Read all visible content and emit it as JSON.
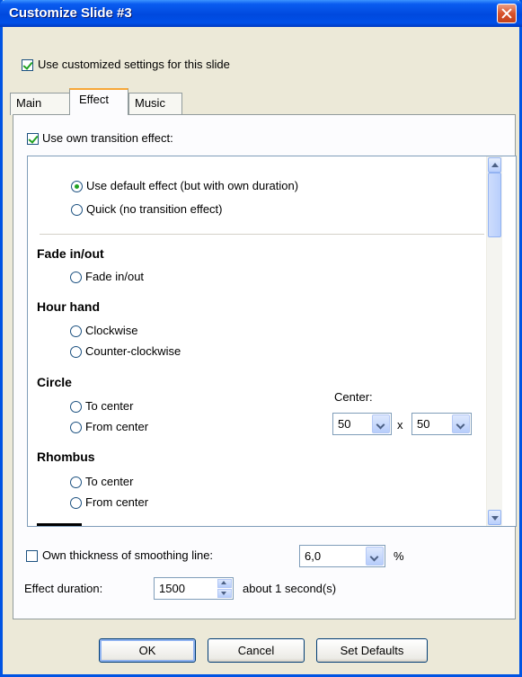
{
  "window": {
    "title": "Customize Slide #3"
  },
  "use_customized": {
    "label": "Use customized settings for this slide",
    "checked": true
  },
  "tabs": [
    {
      "label": "Main",
      "active": false
    },
    {
      "label": "Effect",
      "active": true
    },
    {
      "label": "Music",
      "active": false
    }
  ],
  "own_transition": {
    "label": "Use own transition effect:",
    "checked": true
  },
  "effects": {
    "default_options": [
      {
        "label": "Use default effect (but with own duration)",
        "selected": true
      },
      {
        "label": "Quick (no transition effect)",
        "selected": false
      }
    ],
    "groups": [
      {
        "title": "Fade in/out",
        "options": [
          "Fade in/out"
        ]
      },
      {
        "title": "Hour hand",
        "options": [
          "Clockwise",
          "Counter-clockwise"
        ]
      },
      {
        "title": "Circle",
        "options": [
          "To center",
          "From center"
        ]
      },
      {
        "title": "Rhombus",
        "options": [
          "To center",
          "From center"
        ]
      }
    ],
    "center": {
      "label": "Center:",
      "x_value": "50",
      "separator": "x",
      "y_value": "50"
    }
  },
  "smoothing": {
    "label": "Own thickness of smoothing line:",
    "checked": false,
    "value": "6,0",
    "unit": "%"
  },
  "duration": {
    "label": "Effect duration:",
    "value": "1500",
    "suffix": "about 1 second(s)"
  },
  "buttons": {
    "ok": "OK",
    "cancel": "Cancel",
    "set_defaults": "Set Defaults"
  },
  "colors": {
    "titlebar": "#0049de",
    "accent_check": "#21a121",
    "tab_highlight": "#f7a738",
    "window_bg": "#ece9d8"
  }
}
